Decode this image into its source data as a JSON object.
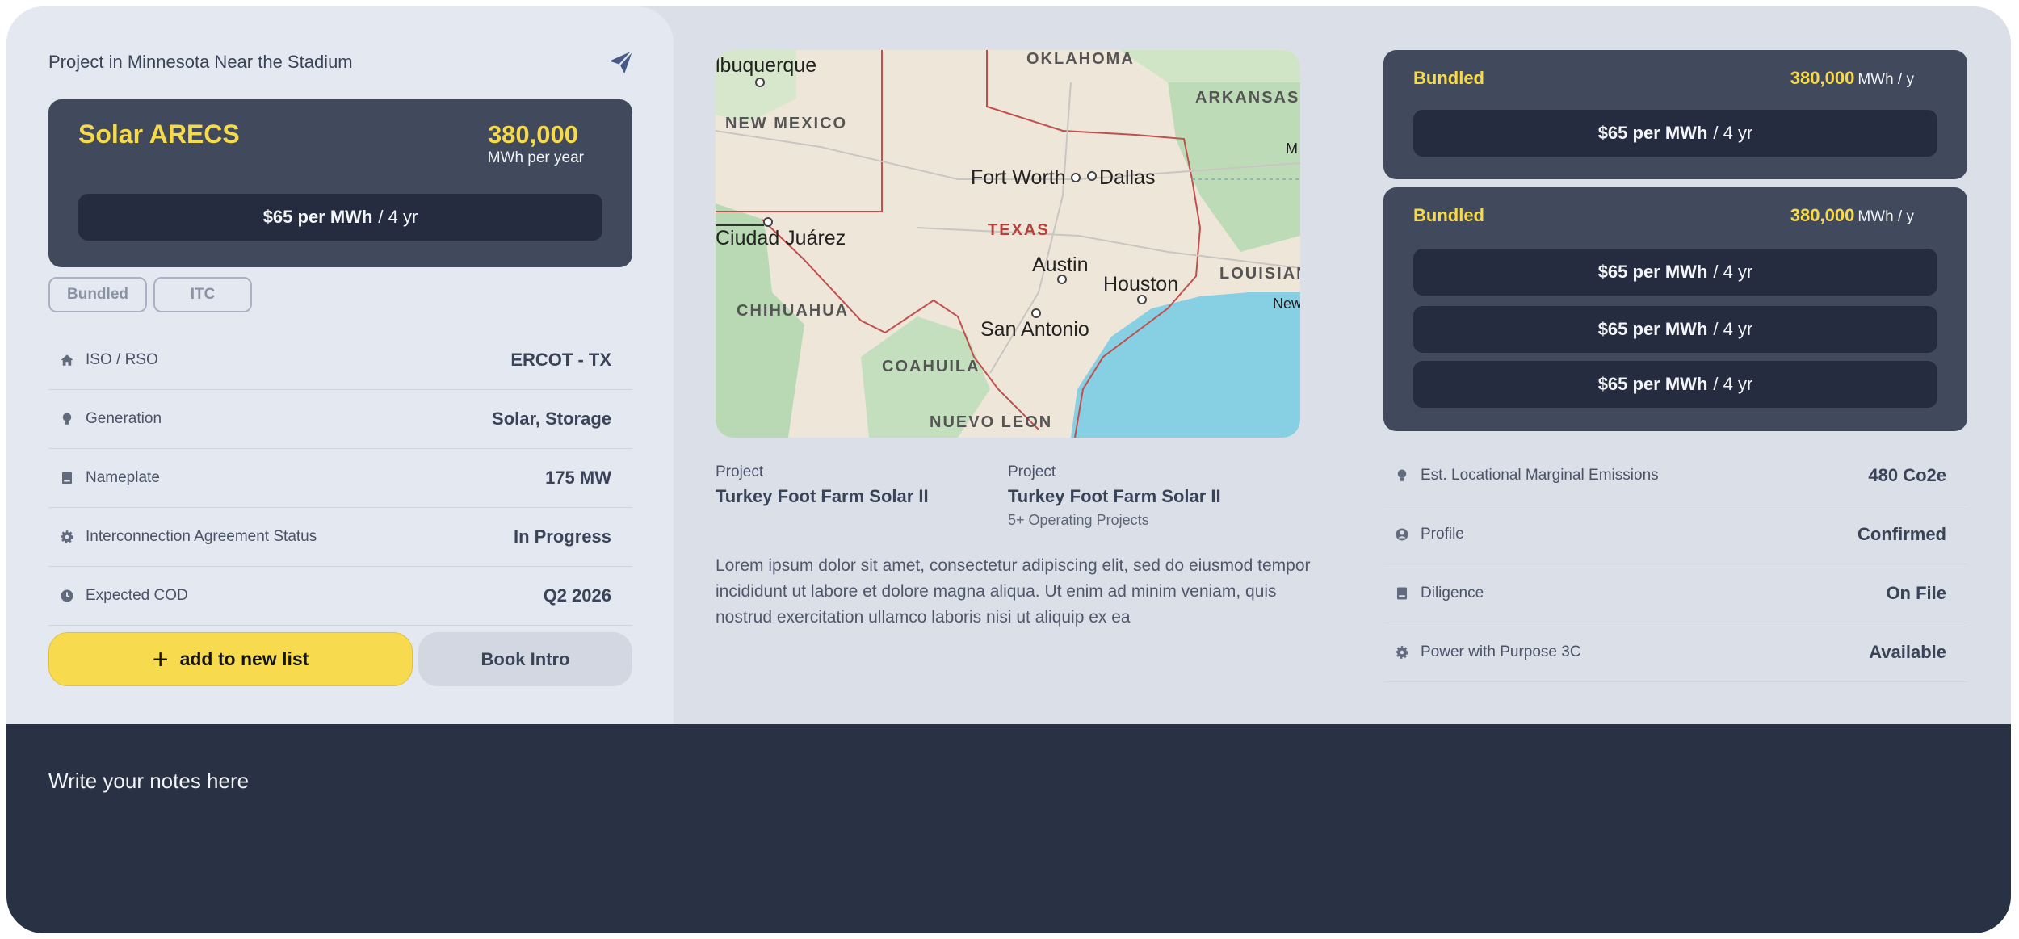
{
  "project": {
    "title": "Project in Minnesota Near the Stadium"
  },
  "hero": {
    "name": "Solar ARECS",
    "value": "380,000",
    "unit": "MWh per year",
    "price_bold": "$65 per MWh",
    "price_term": "/ 4 yr"
  },
  "tags": [
    "Bundled",
    "ITC"
  ],
  "details": [
    {
      "icon": "home-icon",
      "label": "ISO / RSO",
      "value": "ERCOT - TX"
    },
    {
      "icon": "lightbulb-icon",
      "label": "Generation",
      "value": "Solar, Storage"
    },
    {
      "icon": "book-icon",
      "label": "Nameplate",
      "value": "175 MW"
    },
    {
      "icon": "gear-icon",
      "label": "Interconnection Agreement Status",
      "value": "In Progress"
    },
    {
      "icon": "clock-icon",
      "label": "Expected COD",
      "value": "Q2 2026"
    }
  ],
  "actions": {
    "add": "add to new list",
    "book": "Book Intro"
  },
  "map": {
    "labels": [
      "OKLAHOMA",
      "ARKANSAS",
      "NEW MEXICO",
      "TEXAS",
      "LOUISIAN",
      "CHIHUAHUA",
      "COAHUILA",
      "NUEVO LEON"
    ],
    "cities": [
      "lbuquerque",
      "Fort Worth",
      "Dallas",
      "Ciudad Juárez",
      "Austin",
      "Houston",
      "San Antonio",
      "New",
      "M"
    ]
  },
  "middle": {
    "projects": [
      {
        "caption": "Project",
        "name": "Turkey Foot Farm Solar II",
        "sub": ""
      },
      {
        "caption": "Project",
        "name": "Turkey Foot Farm Solar II",
        "sub": "5+ Operating Projects"
      }
    ],
    "description": "Lorem ipsum dolor sit amet, consectetur adipiscing elit, sed do eiusmod tempor incididunt ut labore et dolore magna aliqua. Ut enim ad minim veniam, quis nostrud exercitation ullamco laboris nisi ut aliquip ex ea"
  },
  "bundles": [
    {
      "label": "Bundled",
      "amount": "380,000",
      "unit": "MWh / y",
      "prices": [
        {
          "bold": "$65 per MWh",
          "term": "/ 4 yr"
        }
      ]
    },
    {
      "label": "Bundled",
      "amount": "380,000",
      "unit": "MWh / y",
      "prices": [
        {
          "bold": "$65 per MWh",
          "term": "/ 4 yr"
        },
        {
          "bold": "$65 per MWh",
          "term": "/ 4 yr"
        },
        {
          "bold": "$65 per MWh",
          "term": "/ 4 yr"
        }
      ]
    }
  ],
  "right_details": [
    {
      "icon": "lightbulb-icon",
      "label": "Est. Locational Marginal Emissions",
      "value": "480 Co2e"
    },
    {
      "icon": "user-circle-icon",
      "label": "Profile",
      "value": "Confirmed"
    },
    {
      "icon": "book-icon",
      "label": "Diligence",
      "value": "On File"
    },
    {
      "icon": "gear-icon",
      "label": "Power with Purpose 3C",
      "value": "Available"
    }
  ],
  "notes": {
    "placeholder": "Write your notes here"
  },
  "colors": {
    "accent": "#f7d94c",
    "card_dark": "#404a5c",
    "pill_dark": "#262c40",
    "notes_bg": "#293244"
  }
}
